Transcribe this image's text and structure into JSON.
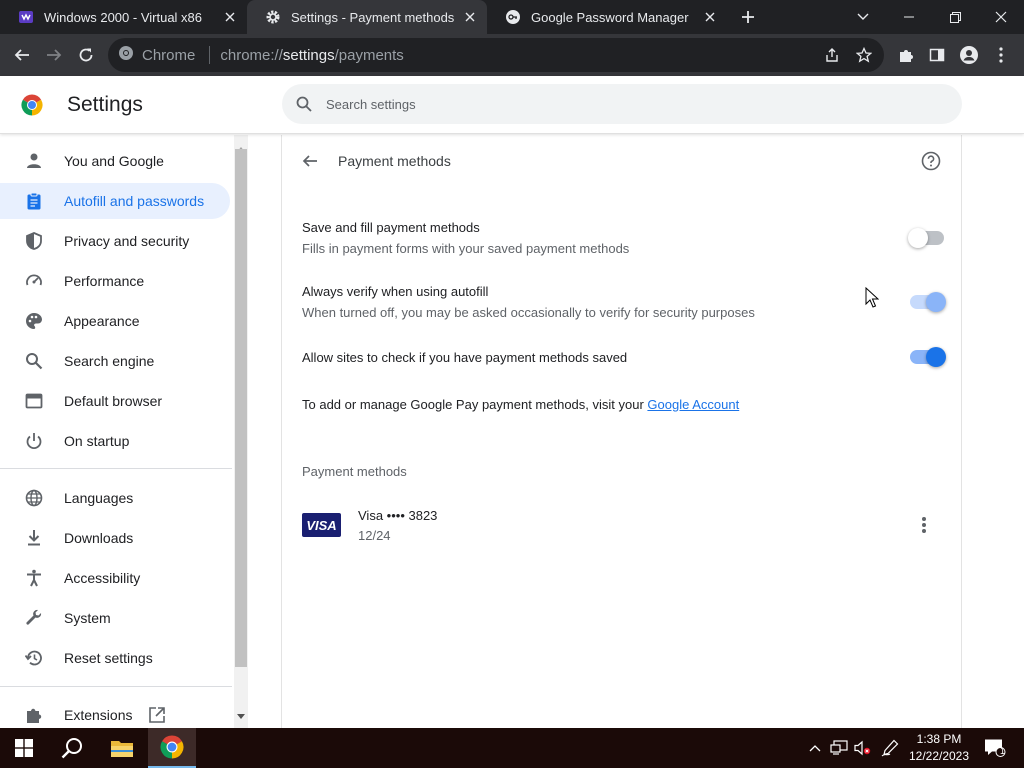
{
  "tabs": [
    {
      "title": "Windows 2000 - Virtual x86",
      "icon": "vm-icon"
    },
    {
      "title": "Settings - Payment methods",
      "icon": "gear-icon"
    },
    {
      "title": "Google Password Manager",
      "icon": "key-icon"
    }
  ],
  "toolbar": {
    "site_label": "Chrome",
    "url_prefix": "chrome://",
    "url_host": "settings",
    "url_path": "/payments"
  },
  "header": {
    "title": "Settings",
    "search_placeholder": "Search settings"
  },
  "sidebar": {
    "items": [
      {
        "label": "You and Google",
        "icon": "person-icon"
      },
      {
        "label": "Autofill and passwords",
        "icon": "clipboard-icon",
        "active": true
      },
      {
        "label": "Privacy and security",
        "icon": "shield-icon"
      },
      {
        "label": "Performance",
        "icon": "speedometer-icon"
      },
      {
        "label": "Appearance",
        "icon": "palette-icon"
      },
      {
        "label": "Search engine",
        "icon": "search-icon"
      },
      {
        "label": "Default browser",
        "icon": "browser-icon"
      },
      {
        "label": "On startup",
        "icon": "power-icon"
      },
      {
        "label": "Languages",
        "icon": "globe-icon"
      },
      {
        "label": "Downloads",
        "icon": "download-icon"
      },
      {
        "label": "Accessibility",
        "icon": "accessibility-icon"
      },
      {
        "label": "System",
        "icon": "wrench-icon"
      },
      {
        "label": "Reset settings",
        "icon": "reset-icon"
      },
      {
        "label": "Extensions",
        "icon": "puzzle-icon"
      }
    ]
  },
  "page": {
    "title": "Payment methods",
    "settings": [
      {
        "primary": "Save and fill payment methods",
        "secondary": "Fills in payment forms with your saved payment methods",
        "state": "off"
      },
      {
        "primary": "Always verify when using autofill",
        "secondary": "When turned off, you may be asked occasionally to verify for security purposes",
        "state": "on-disabled"
      },
      {
        "primary": "Allow sites to check if you have payment methods saved",
        "secondary": "",
        "state": "on"
      }
    ],
    "gpay_text": "To add or manage Google Pay payment methods, visit your",
    "gpay_link": "Google Account",
    "section_title": "Payment methods",
    "cards": [
      {
        "brand": "VISA",
        "name": "Visa •••• 3823",
        "expiry": "12/24"
      }
    ]
  },
  "taskbar": {
    "time": "1:38 PM",
    "date": "12/22/2023",
    "notification_count": "1"
  },
  "colors": {
    "accent": "#1a73e8",
    "active_nav_bg": "#e8f0fe",
    "tabstrip_bg": "#202124",
    "toolbar_bg": "#35363a",
    "taskbar_bg": "#1b0a08",
    "visa_blue": "#1a1f71"
  }
}
